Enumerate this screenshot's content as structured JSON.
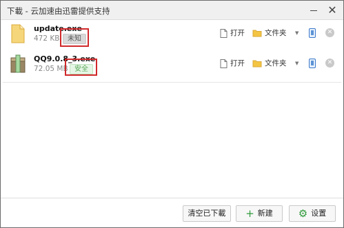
{
  "window": {
    "title": "下載 - 云加速由迅雷提供支持"
  },
  "downloads": [
    {
      "name": "update.exe",
      "size": "472 KB",
      "badge": "未知",
      "badge_type": "unknown",
      "icon": "exe-file-icon"
    },
    {
      "name": "QQ9.0.8_3.exe",
      "size": "72.05 MB",
      "badge": "安全",
      "badge_type": "safe",
      "icon": "qq-installer-icon"
    }
  ],
  "actions": {
    "open": "打开",
    "folder": "文件夹"
  },
  "footer": {
    "clear": "清空已下載",
    "new": "新建",
    "settings": "设置"
  },
  "colors": {
    "safe_text": "#5aa85a",
    "highlight_box": "#d0282a",
    "accent_green": "#2e9a3a",
    "folder_yellow": "#f4c542"
  }
}
